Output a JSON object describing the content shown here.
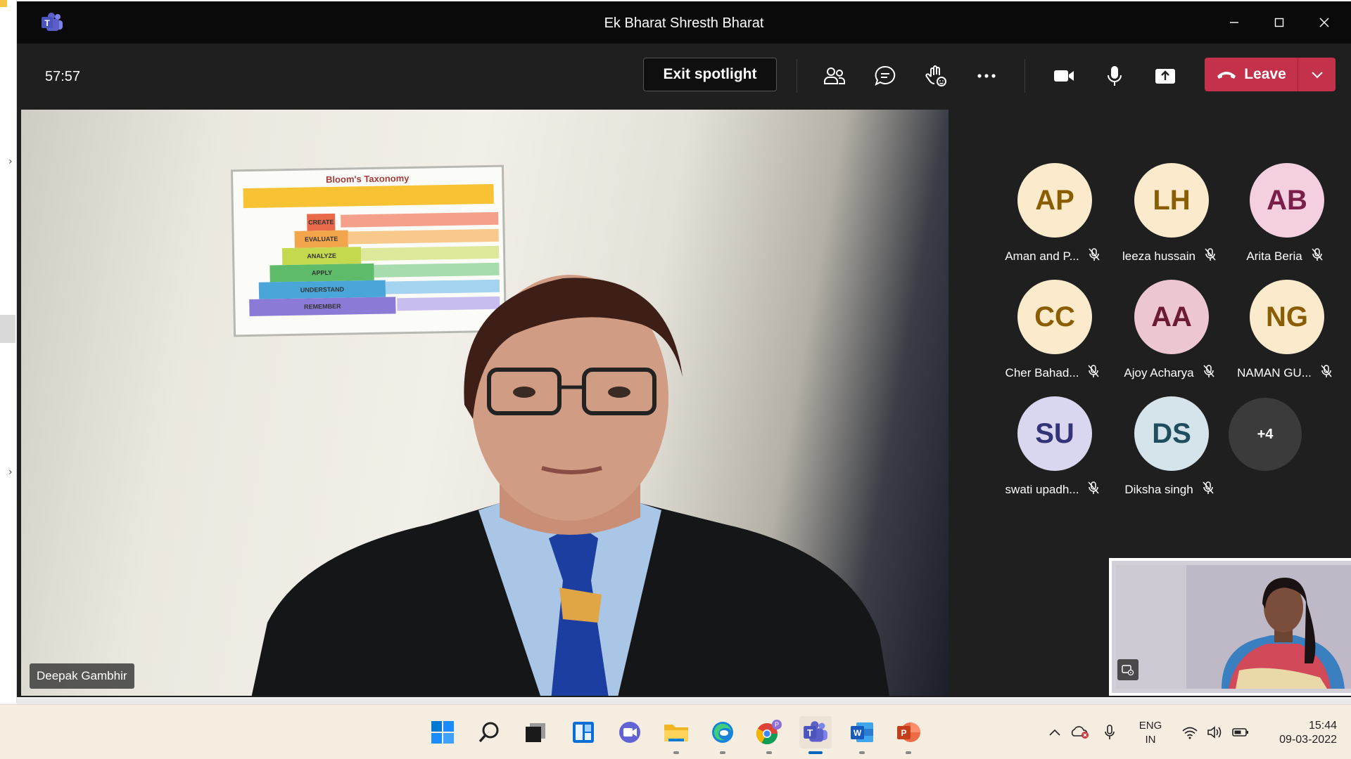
{
  "window": {
    "title": "Ek Bharat Shresth Bharat"
  },
  "toolbar": {
    "timer": "57:57",
    "exit_spotlight_label": "Exit spotlight",
    "leave_label": "Leave",
    "icons": [
      "people-icon",
      "chat-icon",
      "raise-hand-icon",
      "more-icon",
      "camera-icon",
      "mic-icon",
      "share-icon"
    ]
  },
  "main_video": {
    "speaker_name": "Deepak Gambhir",
    "poster": {
      "title": "Bloom's Taxonomy",
      "tiers": [
        "CREATE",
        "EVALUATE",
        "ANALYZE",
        "APPLY",
        "UNDERSTAND",
        "REMEMBER"
      ]
    }
  },
  "participants": [
    {
      "initials": "AP",
      "name": "Aman and P...",
      "avatar_bg": "#fbeacb",
      "avatar_fg": "#8a5d00",
      "muted": true
    },
    {
      "initials": "LH",
      "name": "leeza hussain",
      "avatar_bg": "#fbeacb",
      "avatar_fg": "#8a5d00",
      "muted": true
    },
    {
      "initials": "AB",
      "name": "Arita Beria",
      "avatar_bg": "#f4cfe0",
      "avatar_fg": "#7a1f4a",
      "muted": true
    },
    {
      "initials": "CC",
      "name": "Cher Bahad...",
      "avatar_bg": "#fbeacb",
      "avatar_fg": "#8a5d00",
      "muted": true
    },
    {
      "initials": "AA",
      "name": "Ajoy Acharya",
      "avatar_bg": "#ecc7d2",
      "avatar_fg": "#6b1b33",
      "muted": true
    },
    {
      "initials": "NG",
      "name": "NAMAN GU...",
      "avatar_bg": "#fbeacb",
      "avatar_fg": "#8a5d00",
      "muted": true
    },
    {
      "initials": "SU",
      "name": "swati upadh...",
      "avatar_bg": "#d9d6f0",
      "avatar_fg": "#333377",
      "muted": true
    },
    {
      "initials": "DS",
      "name": "Diksha singh",
      "avatar_bg": "#d4e4ea",
      "avatar_fg": "#1f4e5f",
      "muted": true
    }
  ],
  "more_participants": "+4",
  "taskbar": {
    "apps": [
      "windows-start-icon",
      "search-icon",
      "task-view-icon",
      "widgets-icon",
      "chat-icon",
      "file-explorer-icon",
      "edge-icon",
      "chrome-icon",
      "teams-icon",
      "word-icon",
      "powerpoint-icon"
    ],
    "language_line1": "ENG",
    "language_line2": "IN",
    "time": "15:44",
    "date": "09-03-2022"
  },
  "colors": {
    "leave": "#c4314b",
    "teams_purple": "#5b5fc7",
    "dark_bg": "#1f1f1f"
  }
}
